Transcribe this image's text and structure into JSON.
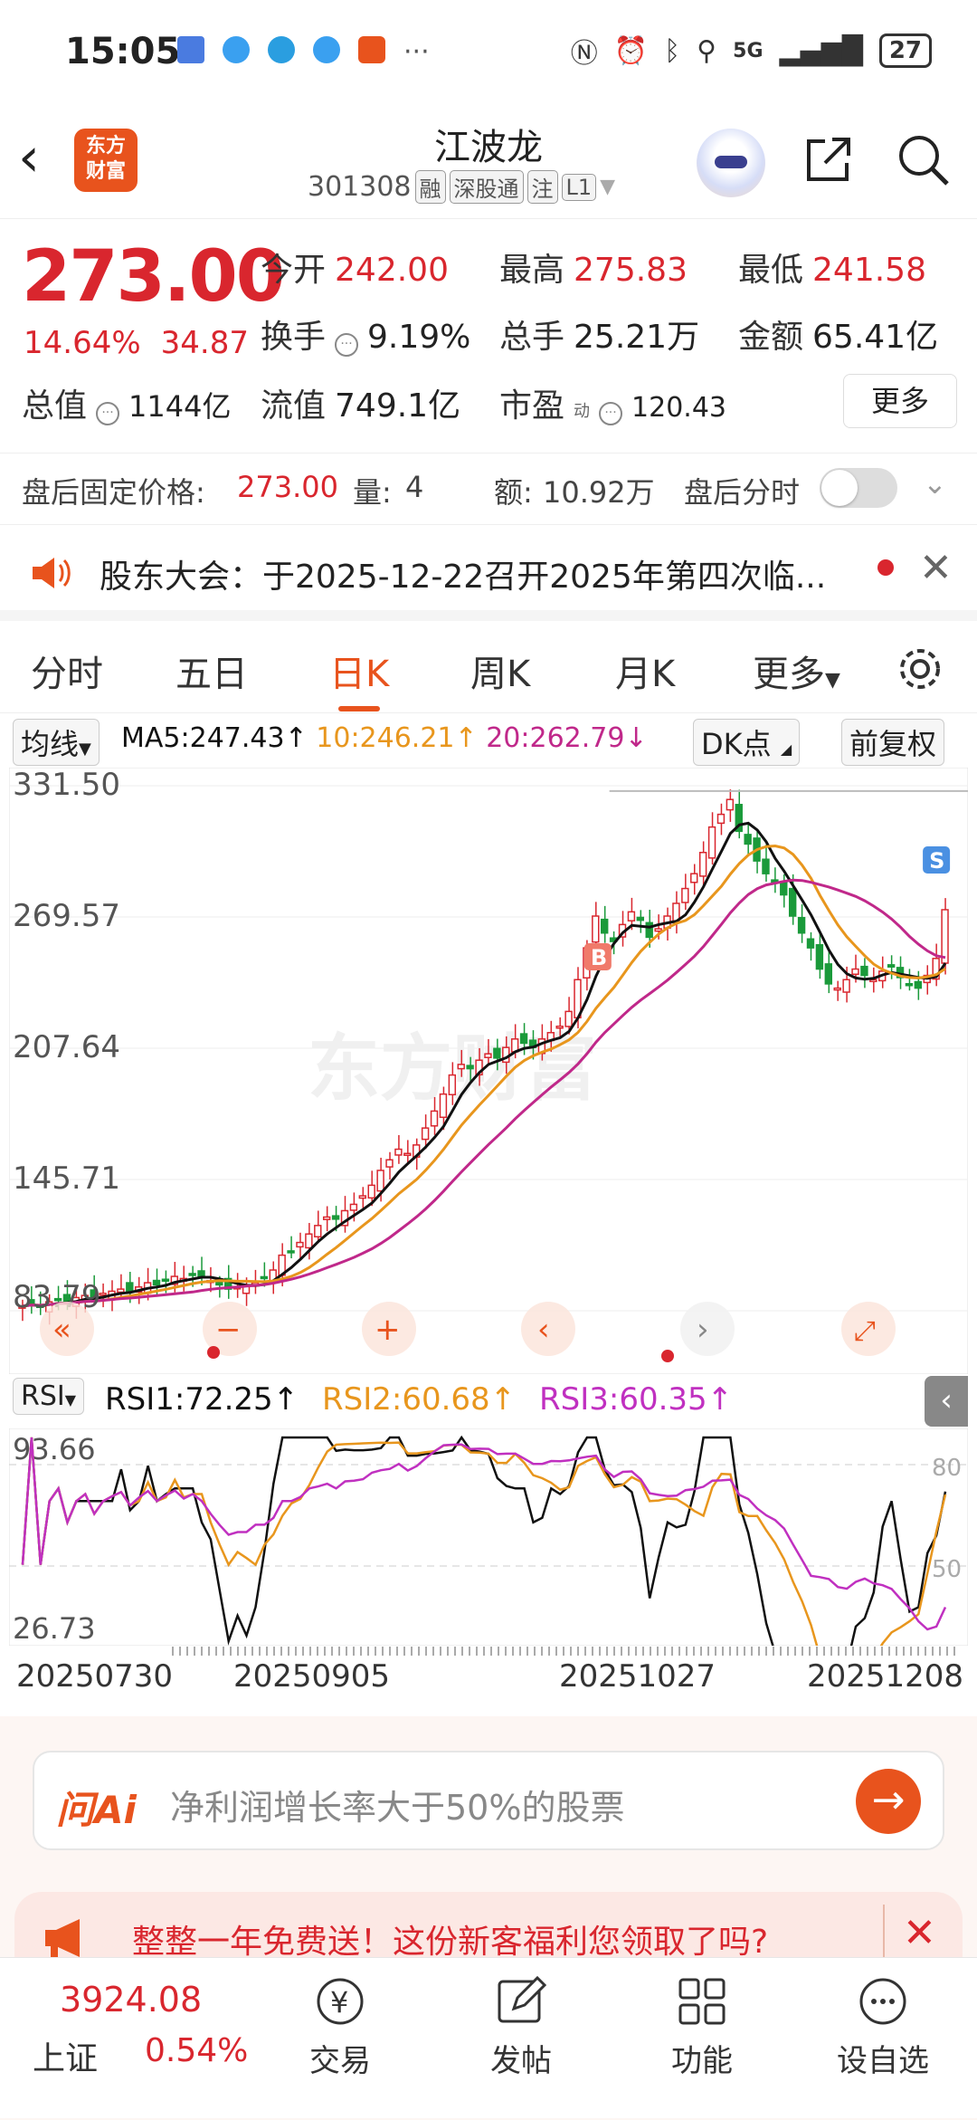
{
  "status_bar": {
    "time": "15:05",
    "battery": "27",
    "network": "5G"
  },
  "header": {
    "logo_text": "东方\n财富",
    "title": "江波龙",
    "code": "301308",
    "tags": [
      "融",
      "深股通",
      "注",
      "L1"
    ]
  },
  "quote": {
    "price": "273.00",
    "change_pct": "14.64%",
    "change_amt": "34.87",
    "open_label": "今开",
    "open": "242.00",
    "high_label": "最高",
    "high": "275.83",
    "low_label": "最低",
    "low": "241.58",
    "turnover_label": "换手",
    "turnover": "9.19%",
    "volume_label": "总手",
    "volume": "25.21万",
    "amount_label": "金额",
    "amount": "65.41亿",
    "mktcap_label": "总值",
    "mktcap": "1144亿",
    "float_label": "流值",
    "float": "749.1亿",
    "pe_label": "市盈",
    "pe_sup": "动",
    "pe": "120.43",
    "more_label": "更多"
  },
  "after_hours": {
    "price_label": "盘后固定价格:",
    "price": "273.00",
    "vol_label": "量:",
    "vol": "4",
    "amt_label": "额:",
    "amt": "10.92万",
    "intraday_label": "盘后分时"
  },
  "notice": {
    "text": "股东大会：于2025-12-22召开2025年第四次临..."
  },
  "tabs": [
    "分时",
    "五日",
    "日K",
    "周K",
    "月K",
    "更多"
  ],
  "active_tab": 2,
  "ma_bar": {
    "select": "均线",
    "ma5": "MA5:247.43↑",
    "ma10": "10:246.21↑",
    "ma20": "20:262.79↓",
    "dk": "DK点",
    "adjust": "前复权"
  },
  "chart_data": {
    "type": "candlestick",
    "y_ticks": [
      "331.50",
      "269.57",
      "207.64",
      "145.71",
      "83.79"
    ],
    "ylim": [
      83.79,
      331.5
    ],
    "watermark": "东方财富",
    "markers": [
      "B",
      "S"
    ],
    "colors": {
      "up": "#d9262e",
      "down": "#1a9a3a",
      "ma5": "#111111",
      "ma10": "#e8961d",
      "ma20": "#c0288a"
    },
    "closes": [
      86,
      87,
      86,
      88,
      89,
      88,
      90,
      91,
      90,
      92,
      93,
      94,
      93,
      95,
      97,
      96,
      98,
      100,
      99,
      101,
      100,
      98,
      96,
      94,
      95,
      96,
      97,
      99,
      103,
      110,
      112,
      116,
      120,
      124,
      128,
      127,
      131,
      134,
      138,
      143,
      150,
      155,
      160,
      158,
      162,
      170,
      178,
      186,
      195,
      200,
      198,
      202,
      205,
      203,
      208,
      212,
      210,
      208,
      212,
      215,
      218,
      225,
      240,
      255,
      270,
      262,
      258,
      266,
      272,
      268,
      260,
      264,
      270,
      276,
      283,
      290,
      300,
      312,
      318,
      325,
      310,
      304,
      296,
      290,
      286,
      280,
      270,
      262,
      255,
      245,
      238,
      236,
      240,
      245,
      242,
      240,
      244,
      246,
      241,
      238,
      236,
      242,
      250,
      273
    ]
  },
  "rsi": {
    "select": "RSI",
    "rsi1": "RSI1:72.25↑",
    "rsi2": "RSI2:60.68↑",
    "rsi3": "RSI3:60.35↑",
    "top": "93.66",
    "bottom": "26.73",
    "level80": "80",
    "level50": "50",
    "colors": {
      "rsi1": "#111111",
      "rsi2": "#e8961d",
      "rsi3": "#c030c0"
    }
  },
  "dates": [
    "20250730",
    "20250905",
    "20251027",
    "20251208"
  ],
  "ask_ai": {
    "logo": "问Ai",
    "placeholder": "净利润增长率大于50%的股票"
  },
  "promo": {
    "text": "整整一年免费送！这份新客福利您领取了吗?"
  },
  "bottom_nav": {
    "index_name": "上证",
    "index_value": "3924.08",
    "index_change": "0.54%",
    "items": [
      "交易",
      "发帖",
      "功能",
      "设自选"
    ]
  }
}
